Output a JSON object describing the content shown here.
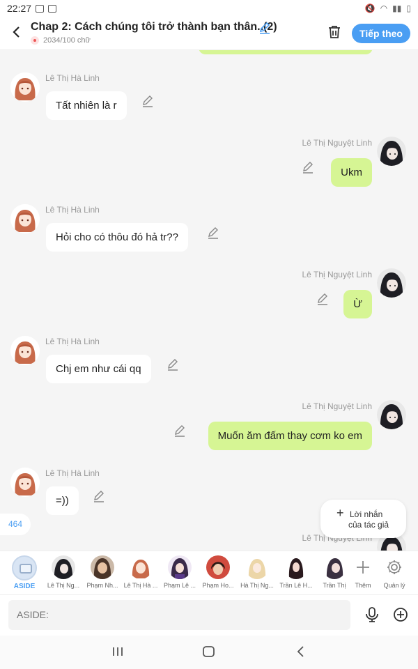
{
  "status": {
    "time": "22:27"
  },
  "header": {
    "title": "Chap 2: Cách chúng tôi trở thành bạn thân..(2)",
    "word_count": "2034/100 chữ",
    "next_label": "Tiếp theo"
  },
  "messages": [
    {
      "side": "left",
      "name": "Lê Thị Hà Linh",
      "text": "Tất nhiên là r"
    },
    {
      "side": "right",
      "name": "Lê Thị Nguyệt Linh",
      "text": "Ukm"
    },
    {
      "side": "left",
      "name": "Lê Thị Hà Linh",
      "text": "Hỏi cho có thôu đó hả tr??"
    },
    {
      "side": "right",
      "name": "Lê Thị Nguyệt Linh",
      "text": "Ừ"
    },
    {
      "side": "left",
      "name": "Lê Thị Hà Linh",
      "text": "Chj em như cái qq"
    },
    {
      "side": "right",
      "name": "Lê Thị Nguyệt Linh",
      "text": "Muốn ăm đấm thay cơm ko em"
    },
    {
      "side": "left",
      "name": "Lê Thị Hà Linh",
      "text": "=))"
    },
    {
      "side": "right",
      "name": "Lê Thị Nguyệt Linh",
      "text": ""
    }
  ],
  "counter": "464",
  "author_note": {
    "line1": "Lời nhắn",
    "line2": "của tác giả"
  },
  "characters": {
    "aside": "ASIDE",
    "items": [
      {
        "label": "Lê Thị Ng..."
      },
      {
        "label": "Phạm Nh..."
      },
      {
        "label": "Lê Thị Hà ..."
      },
      {
        "label": "Phạm Lê ..."
      },
      {
        "label": "Phạm Ho..."
      },
      {
        "label": "Hà Thị Ng..."
      },
      {
        "label": "Trần Lê H..."
      },
      {
        "label": "Trần Thị"
      }
    ],
    "add_label": "Thêm",
    "manage_label": "Quản lý"
  },
  "input": {
    "placeholder": "ASIDE:"
  },
  "colors": {
    "accent": "#4a9ef3",
    "right_bubble": "#d6f594"
  }
}
